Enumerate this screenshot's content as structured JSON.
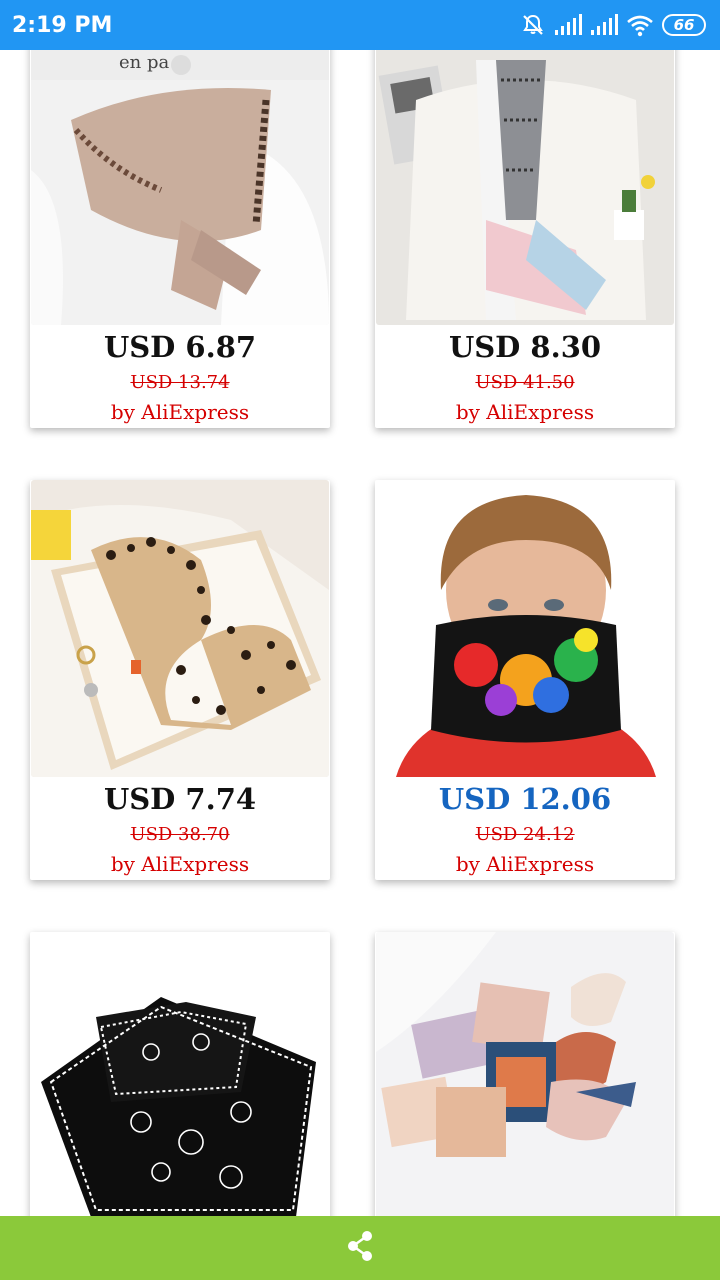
{
  "status_bar": {
    "time": "2:19 PM",
    "battery": "66",
    "icons": [
      "silent-icon",
      "signal-icon",
      "signal-icon",
      "wifi-icon",
      "battery-icon"
    ]
  },
  "products": [
    {
      "price": "USD 6.87",
      "old_price": "USD 13.74",
      "seller": "by AliExpress"
    },
    {
      "price": "USD 8.30",
      "old_price": "USD 41.50",
      "seller": "by AliExpress"
    },
    {
      "price": "USD 7.74",
      "old_price": "USD 38.70",
      "seller": "by AliExpress"
    },
    {
      "price": "USD 12.06",
      "old_price": "USD 24.12",
      "seller": "by AliExpress"
    }
  ],
  "product_images": [
    {
      "text": "en pa"
    },
    {
      "text": ""
    },
    {
      "text": ""
    },
    {
      "text": ""
    },
    {
      "text": ""
    },
    {
      "text": ""
    }
  ],
  "bottom_bar": {
    "icon": "share-icon"
  },
  "colors": {
    "status_bar": "#2196f3",
    "bottom_bar": "#8bc93a",
    "old_price": "#d50000",
    "seller": "#d50000",
    "highlight_price": "#1565c0"
  }
}
